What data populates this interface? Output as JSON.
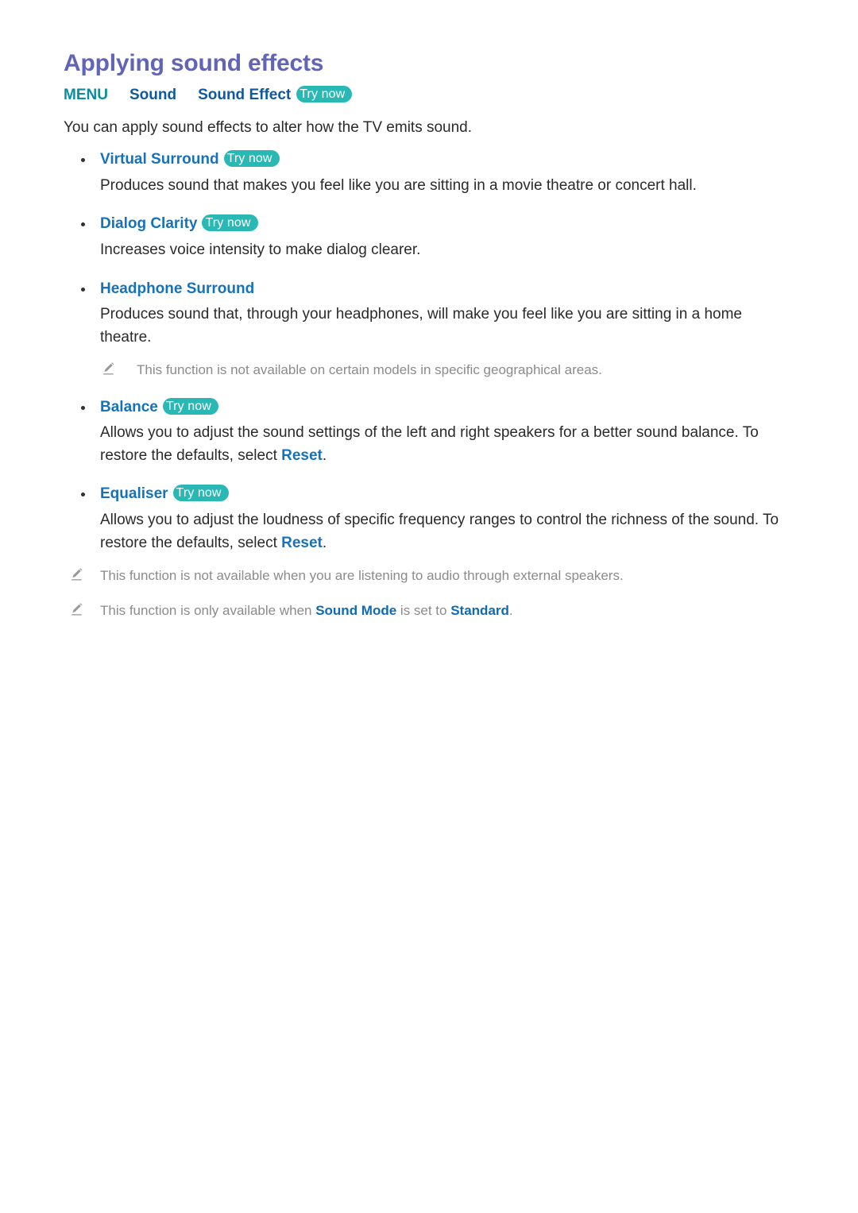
{
  "document": {
    "title": "Applying sound effects",
    "intro": "You can apply sound effects to alter how the TV emits sound.",
    "try_now_label": "Try now"
  },
  "menu_path": {
    "root": "MENU",
    "step1": "Sound",
    "step2": "Sound Effect",
    "try_now": "Try now"
  },
  "features": [
    {
      "label": "Virtual Surround",
      "try_now": "Try now",
      "description": "Produces sound that makes you feel like you are sitting in a movie theatre or concert hall."
    },
    {
      "label": "Dialog Clarity",
      "try_now": "Try now",
      "description": "Increases voice intensity to make dialog clearer."
    },
    {
      "label": "Headphone Surround",
      "try_now": "",
      "description": "Produces sound that, through your headphones, will make you feel like you are sitting in a home theatre.",
      "note": "This function is not available on certain models in specific geographical areas."
    },
    {
      "label": "Balance",
      "try_now": "Try now",
      "description_before": "Allows you to adjust the sound settings of the left and right speakers for a better sound balance. To restore the defaults, select ",
      "description_keyword": "Reset",
      "description_after": "."
    },
    {
      "label": "Equaliser",
      "try_now": "Try now",
      "description_before": "Allows you to adjust the loudness of specific frequency ranges to control the richness of the sound. To restore the defaults, select ",
      "description_keyword": "Reset",
      "description_after": "."
    }
  ],
  "footer_notes": [
    {
      "text": "This function is not available when you are listening to audio through external speakers."
    },
    {
      "before": "This function is only available when ",
      "keyword1": "Sound Mode",
      "middle": " is set to ",
      "keyword2": "Standard",
      "after": "."
    }
  ],
  "colors": {
    "title_purple": "#6265b6",
    "menu_teal": "#0b8da0",
    "menu_blue": "#10599f",
    "heading_blue": "#1572bb",
    "badge_teal": "#2ab8b4",
    "body_text": "#2a2a2a",
    "note_gray": "#8b8b8b"
  }
}
